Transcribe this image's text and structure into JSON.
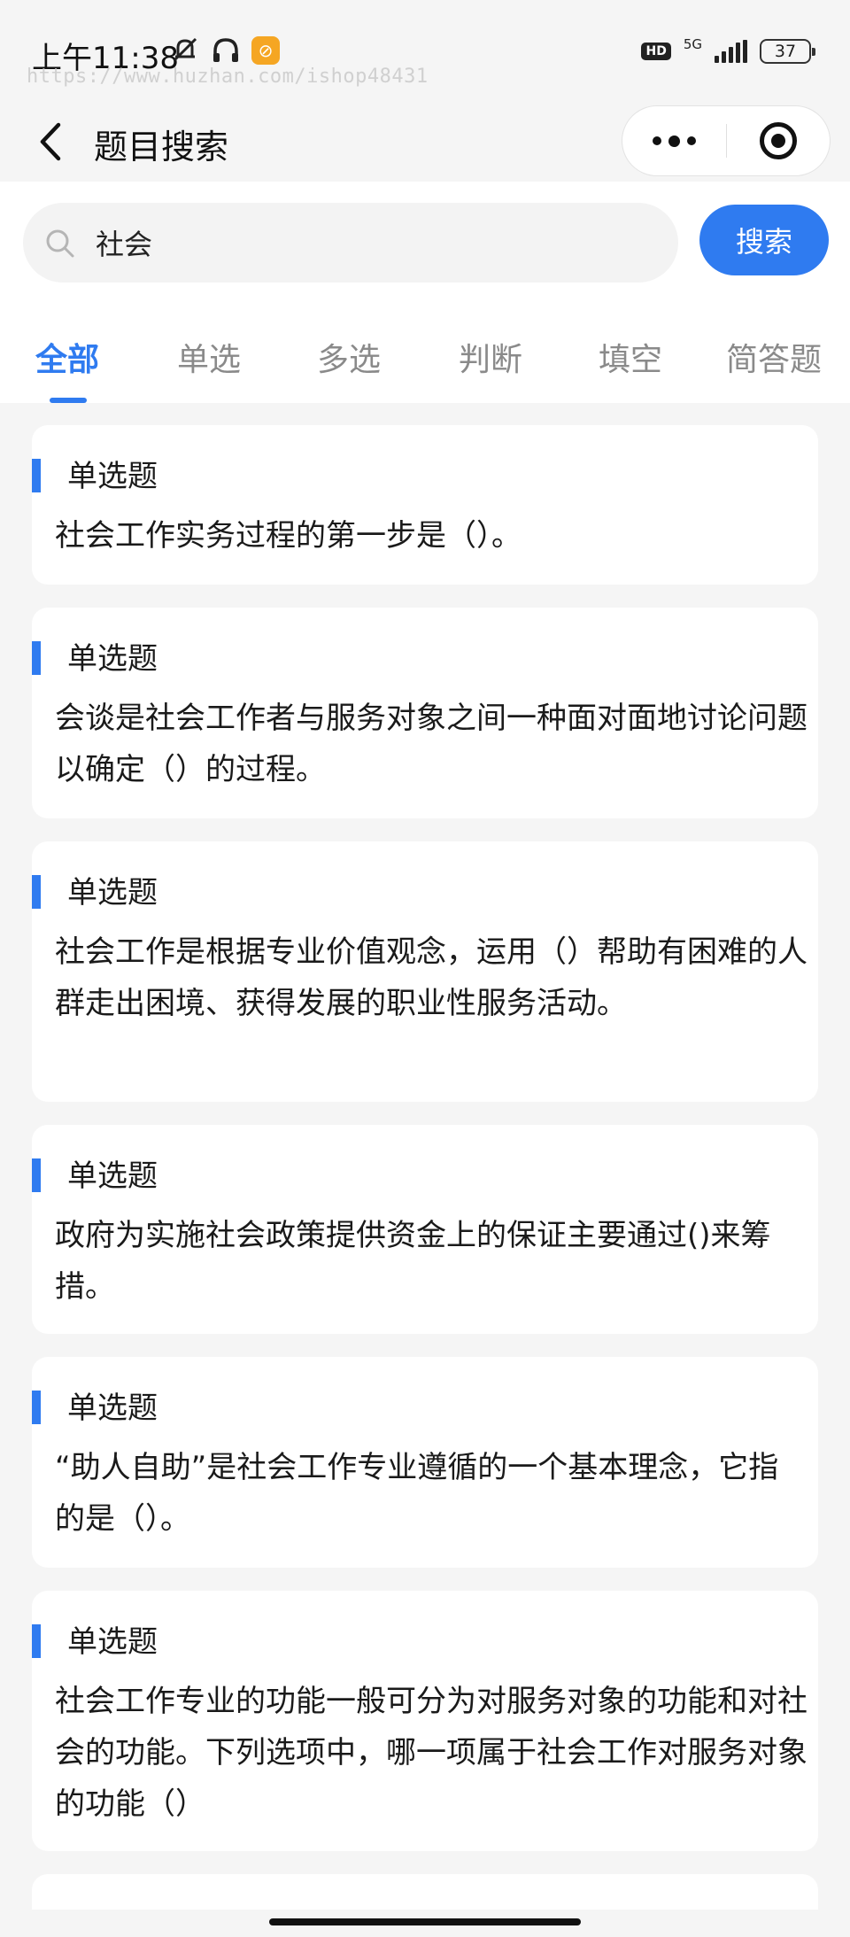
{
  "status_bar": {
    "time": "上午11:38",
    "watermark": "https://www.huzhan.com/ishop48431",
    "hd": "HD",
    "network": "5G",
    "battery": "37"
  },
  "nav": {
    "title": "题目搜索"
  },
  "search": {
    "query": "社会",
    "button_label": "搜索"
  },
  "tabs": [
    {
      "label": "全部",
      "active": true
    },
    {
      "label": "单选",
      "active": false
    },
    {
      "label": "多选",
      "active": false
    },
    {
      "label": "判断",
      "active": false
    },
    {
      "label": "填空",
      "active": false
    },
    {
      "label": "简答题",
      "active": false
    }
  ],
  "colors": {
    "accent": "#2f7bf0",
    "background": "#f5f5f5"
  },
  "questions": [
    {
      "type": "单选题",
      "text": "社会工作实务过程的第一步是（）。"
    },
    {
      "type": "单选题",
      "text": "会谈是社会工作者与服务对象之间一种面对面地讨论问题以确定（）的过程。"
    },
    {
      "type": "单选题",
      "text": "社会工作是根据专业价值观念，运用（）帮助有困难的人群走出困境、获得发展的职业性服务活动。"
    },
    {
      "type": "单选题",
      "text": "政府为实施社会政策提供资金上的保证主要通过()来筹措。"
    },
    {
      "type": "单选题",
      "text": "“助人自助”是社会工作专业遵循的一个基本理念，它指的是（）。"
    },
    {
      "type": "单选题",
      "text": "社会工作专业的功能一般可分为对服务对象的功能和对社会的功能。下列选项中，哪一项属于社会工作对服务对象的功能（）"
    }
  ]
}
